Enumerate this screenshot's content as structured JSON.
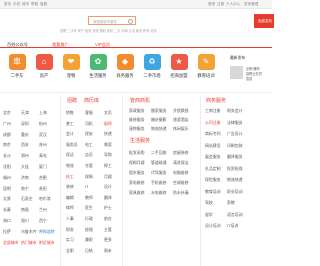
{
  "topbar": {
    "items": [
      "首页",
      "手机",
      "城市",
      "帮助",
      "客服"
    ],
    "right_items": [
      "登录",
      "注册",
      "个人中心",
      "发布管理"
    ]
  },
  "search": {
    "placeholder": "请搜索城市服务"
  },
  "hotwords": "招聘 二手车 房产 租房 宠物 兼职 家政 二手 车辆 生活 服务 教育 培训",
  "publish_button": "免费发布",
  "navbar": {
    "city": "百姓公众号",
    "nav_items": [
      "我要推广",
      "VIP会员"
    ]
  },
  "categories": [
    {
      "label": "二手车",
      "glyph": "車",
      "color": "#f38b2f"
    },
    {
      "label": "房产",
      "glyph": "⌂",
      "color": "#ee5a46"
    },
    {
      "label": "宠物",
      "glyph": "❤",
      "color": "#f3a233"
    },
    {
      "label": "生活服务",
      "glyph": "✿",
      "color": "#4fb872"
    },
    {
      "label": "商务服务",
      "glyph": "◆",
      "color": "#f38b2f"
    },
    {
      "label": "二手市场",
      "glyph": "♻",
      "color": "#3fa7e0"
    },
    {
      "label": "招商加盟",
      "glyph": "★",
      "color": "#ee5a46"
    },
    {
      "label": "教育培训",
      "glyph": "✎",
      "color": "#f3a233"
    }
  ],
  "right_box": {
    "title": "最新发布",
    "lines": [
      "全职/兼职",
      "招聘业务员",
      "急招"
    ]
  },
  "col1": {
    "rows": [
      [
        "北京",
        "天津",
        "上海"
      ],
      [
        "广州",
        "深圳",
        "杭州"
      ],
      [
        "成都",
        "重庆",
        "武汉"
      ],
      [
        "南京",
        "西安",
        "苏州"
      ],
      [
        "长沙",
        "郑州",
        "青岛"
      ],
      [
        "沈阳",
        "大连",
        "厦门"
      ],
      [
        "福州",
        "济南",
        "合肥"
      ],
      [
        "昆明",
        "南宁",
        "贵阳"
      ],
      [
        "太原",
        "石家庄",
        "哈尔滨"
      ],
      [
        "长春",
        "南昌",
        "兰州"
      ],
      [
        "海口",
        "银川",
        "西宁"
      ],
      [
        "拉萨",
        "乌鲁木齐",
        "呼和浩特"
      ],
      [
        "全部城市",
        "热门城市",
        "附近城市"
      ]
    ]
  },
  "col2": {
    "head1": "招聘",
    "head2": "简历库",
    "rows": [
      [
        "销售",
        "客服",
        "文员"
      ],
      [
        "普工",
        "司机",
        "厨师"
      ],
      [
        "会计",
        "保安",
        "快递"
      ],
      [
        "服务员",
        "电工",
        "美容"
      ],
      [
        "保洁",
        "店员",
        "导购"
      ],
      [
        "物流",
        "仓管",
        "焊工"
      ],
      [
        "技工",
        "保姆",
        "月嫂"
      ],
      [
        "装修",
        "IT",
        "设计"
      ],
      [
        "编辑",
        "教师",
        "翻译"
      ],
      [
        "律师",
        "医生",
        "护士"
      ],
      [
        "人事",
        "行政",
        "前台"
      ],
      [
        "财务",
        "经理",
        "主管"
      ],
      [
        "实习",
        "兼职",
        "更多"
      ],
      [
        "全职",
        "日结",
        "周末"
      ]
    ]
  },
  "col3": {
    "head1": "管商商机",
    "head2": "生活服务",
    "rows": [
      [
        "家政服务",
        "搬家服务",
        "开锁换锁"
      ],
      [
        "维修服务",
        "婚庆摄影",
        "旅游酒店"
      ],
      [
        "宠物服务",
        "物流快递",
        "休闲娱乐"
      ],
      [
        "批发采购",
        "二手回收",
        "房屋装修"
      ],
      [
        "保姆月嫂",
        "管道疏通",
        "清洗保洁"
      ],
      [
        "租车服务",
        "代驾服务",
        "电脑维修"
      ],
      [
        "家电维修",
        "手机维修",
        "空调维修"
      ],
      [
        "家具维修",
        "水电维修",
        "防水补漏"
      ]
    ]
  },
  "col4": {
    "head1": "商务服务",
    "rows": [
      [
        "工商注册",
        "财务会计"
      ],
      [
        "公司注册",
        "法律服务"
      ],
      [
        "商标专利",
        "广告设计"
      ],
      [
        "网站建设",
        "印刷包装"
      ],
      [
        "展会服务",
        "翻译服务"
      ],
      [
        "礼品定制",
        "投资担保"
      ],
      [
        "保险服务",
        "物流快递"
      ],
      [
        "教育培训",
        "职业培训"
      ],
      [
        "驾校",
        "家教"
      ],
      [
        "留学",
        "语言培训"
      ],
      [
        "设计培训",
        "IT培训"
      ]
    ]
  },
  "colors": {
    "accent": "#e93a2e",
    "link_blue": "#3b6fc4"
  }
}
